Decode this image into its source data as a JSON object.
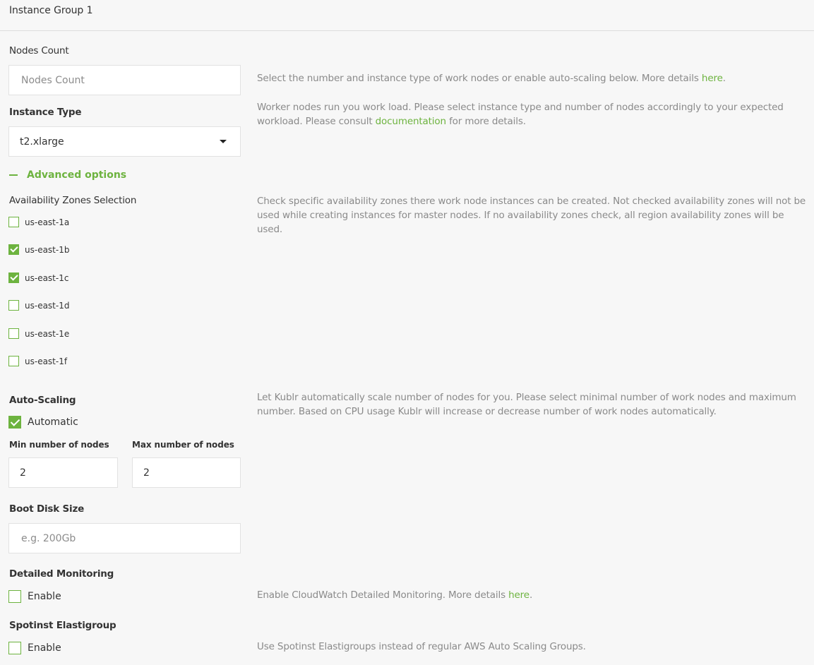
{
  "group": {
    "title": "Instance Group 1"
  },
  "nodes_count": {
    "label": "Nodes Count",
    "value": "",
    "placeholder": "Nodes Count",
    "help_prefix": "Select the number and instance type of work nodes or enable auto-scaling below. More details ",
    "help_link": "here",
    "help_suffix": "."
  },
  "instance_type": {
    "label": "Instance Type",
    "selected": "t2.xlarge",
    "help_prefix": "Worker nodes run you work load. Please select instance type and number of nodes accordingly to your expected workload. Please consult ",
    "help_link": "documentation",
    "help_suffix": " for more details."
  },
  "advanced": {
    "label": "Advanced options"
  },
  "availability_zones": {
    "label": "Availability Zones Selection",
    "help": "Check specific availability zones there work node instances can be created. Not checked availability zones will not be used while creating instances for master nodes. If no availability zones check, all region availability zones will be used.",
    "zones": [
      {
        "name": "us-east-1a",
        "checked": false
      },
      {
        "name": "us-east-1b",
        "checked": true
      },
      {
        "name": "us-east-1c",
        "checked": true
      },
      {
        "name": "us-east-1d",
        "checked": false
      },
      {
        "name": "us-east-1e",
        "checked": false
      },
      {
        "name": "us-east-1f",
        "checked": false
      }
    ]
  },
  "auto_scaling": {
    "label": "Auto-Scaling",
    "automatic_label": "Automatic",
    "automatic_checked": true,
    "help": "Let Kublr automatically scale number of nodes for you. Please select minimal number of work nodes and maximum number. Based on CPU usage Kublr will increase or decrease number of work nodes automatically.",
    "min_label": "Min number of nodes",
    "min_value": "2",
    "max_label": "Max number of nodes",
    "max_value": "2"
  },
  "boot_disk": {
    "label": "Boot Disk Size",
    "value": "",
    "placeholder": "e.g. 200Gb"
  },
  "detailed_monitoring": {
    "label": "Detailed Monitoring",
    "enable_label": "Enable",
    "checked": false,
    "help_prefix": "Enable CloudWatch Detailed Monitoring. More details ",
    "help_link": "here",
    "help_suffix": "."
  },
  "spotinst": {
    "label": "Spotinst Elastigroup",
    "enable_label": "Enable",
    "checked": false,
    "help": "Use Spotinst Elastigroups instead of regular AWS Auto Scaling Groups."
  },
  "colors": {
    "accent": "#6db33f",
    "background": "#f7f7f7",
    "help_text": "#8a8a8a"
  }
}
